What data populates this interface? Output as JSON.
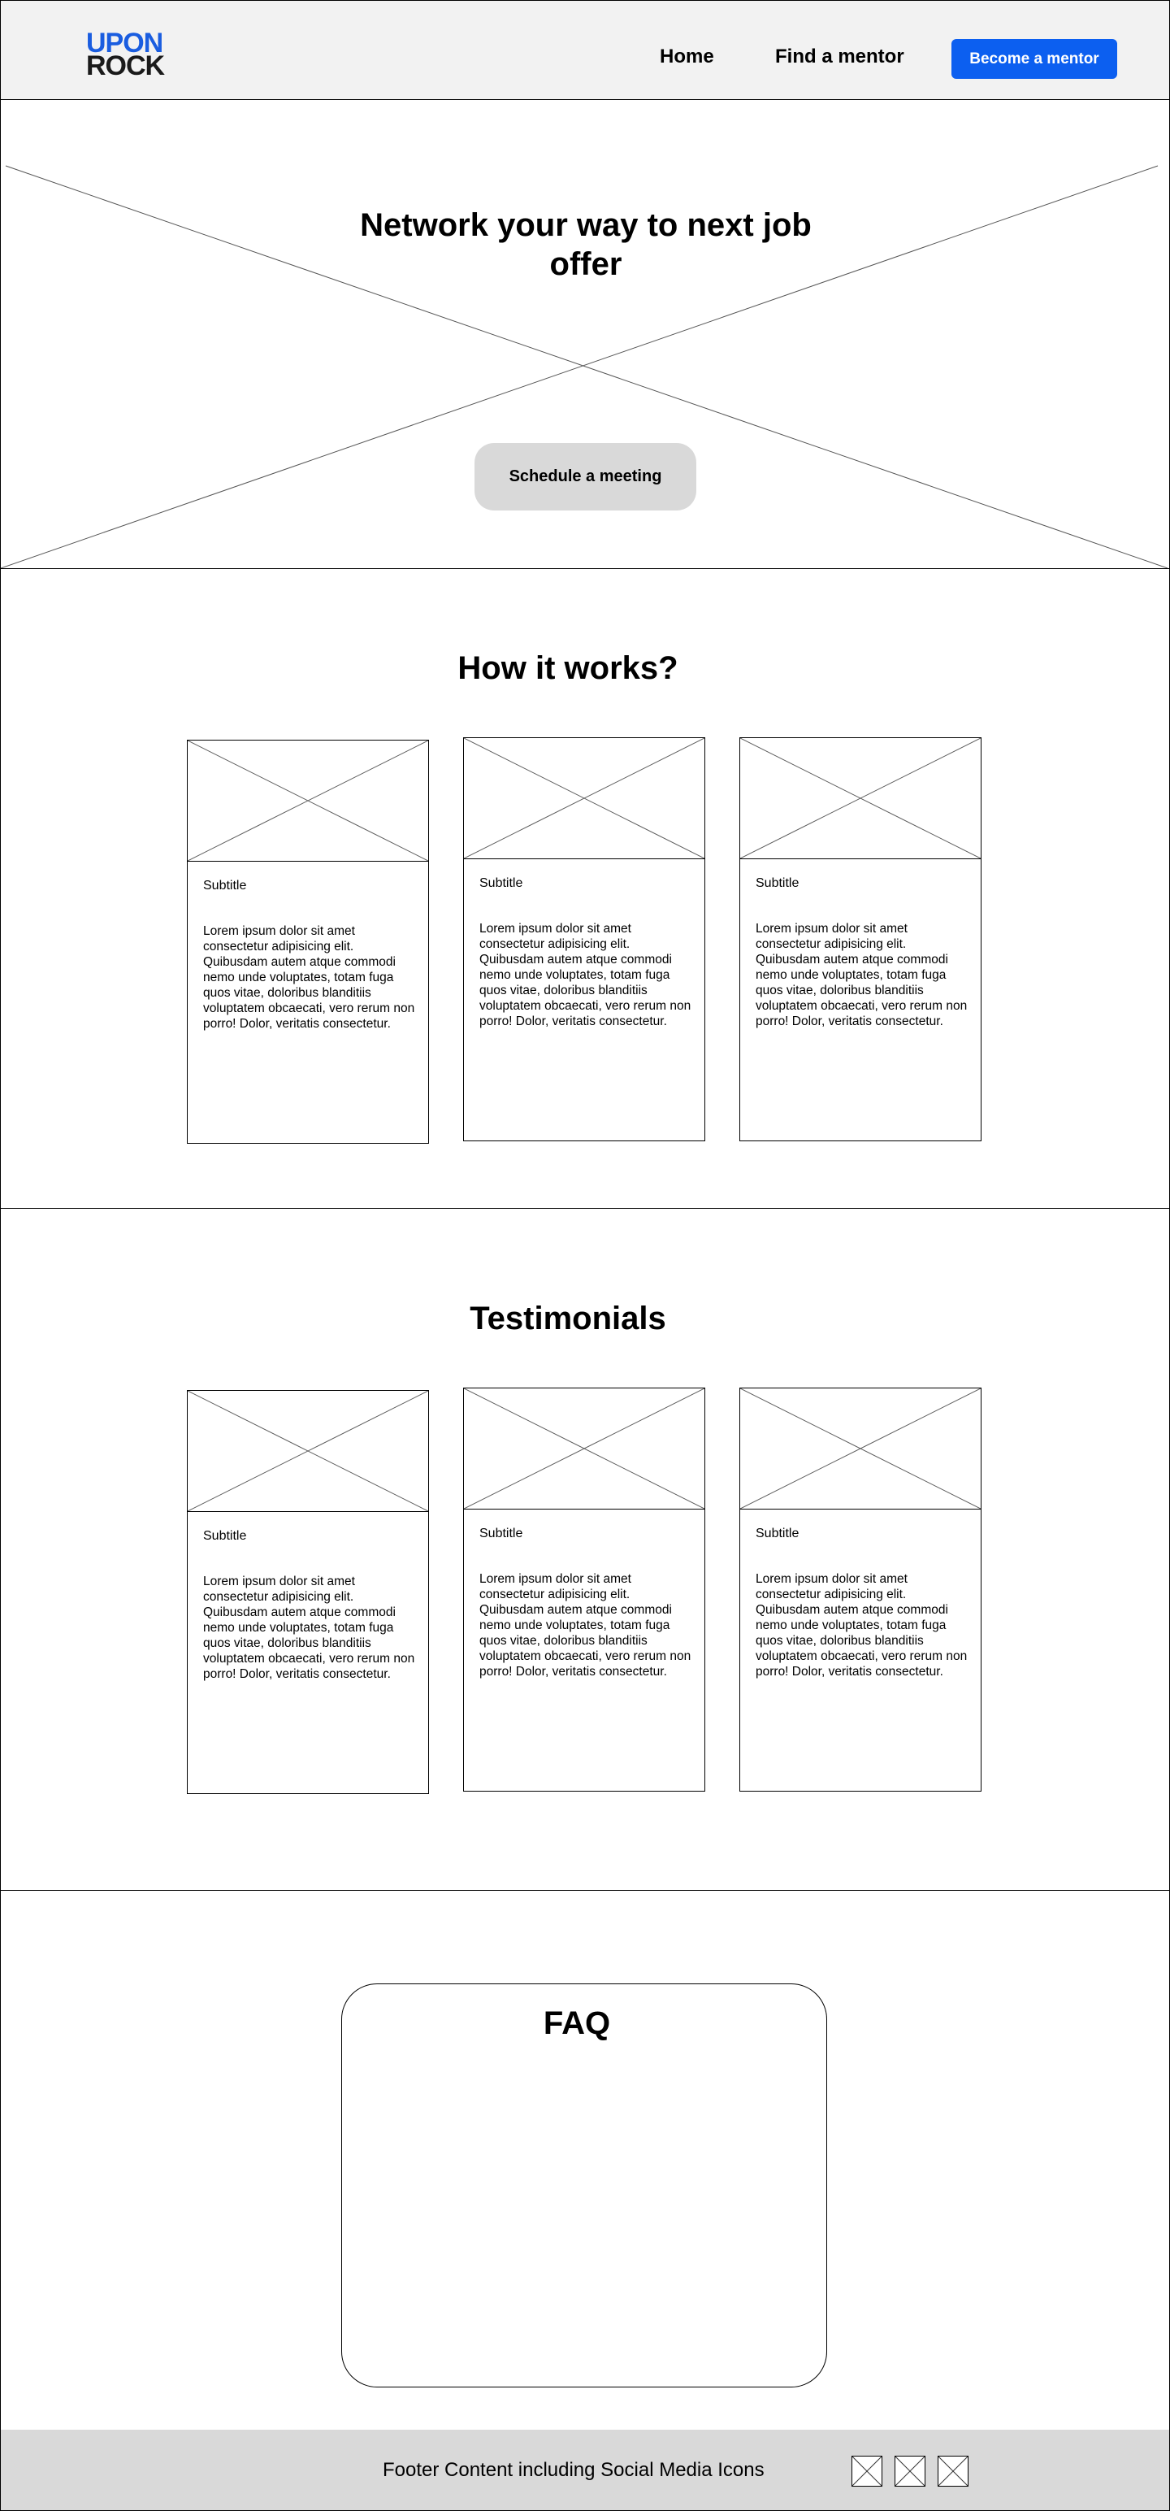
{
  "header": {
    "logo_top": "UPON",
    "logo_bottom": "ROCK",
    "nav_home": "Home",
    "nav_find": "Find a mentor",
    "cta": "Become a mentor"
  },
  "hero": {
    "title": "Network your way to next job offer",
    "button": "Schedule a meeting"
  },
  "how": {
    "title": "How it works?",
    "cards": [
      {
        "subtitle": "Subtitle",
        "body": "Lorem ipsum dolor sit amet consectetur adipisicing elit. Quibusdam autem atque commodi nemo unde voluptates, totam fuga quos vitae, doloribus blanditiis voluptatem obcaecati, vero rerum non porro! Dolor, veritatis consectetur."
      },
      {
        "subtitle": "Subtitle",
        "body": "Lorem ipsum dolor sit amet consectetur adipisicing elit. Quibusdam autem atque commodi nemo unde voluptates, totam fuga quos vitae, doloribus blanditiis voluptatem obcaecati, vero rerum non porro! Dolor, veritatis consectetur."
      },
      {
        "subtitle": "Subtitle",
        "body": "Lorem ipsum dolor sit amet consectetur adipisicing elit. Quibusdam autem atque commodi nemo unde voluptates, totam fuga quos vitae, doloribus blanditiis voluptatem obcaecati, vero rerum non porro! Dolor, veritatis consectetur."
      }
    ]
  },
  "testimonials": {
    "title": "Testimonials",
    "cards": [
      {
        "subtitle": "Subtitle",
        "body": "Lorem ipsum dolor sit amet consectetur adipisicing elit. Quibusdam autem atque commodi nemo unde voluptates, totam fuga quos vitae, doloribus blanditiis voluptatem obcaecati, vero rerum non porro! Dolor, veritatis consectetur."
      },
      {
        "subtitle": "Subtitle",
        "body": "Lorem ipsum dolor sit amet consectetur adipisicing elit. Quibusdam autem atque commodi nemo unde voluptates, totam fuga quos vitae, doloribus blanditiis voluptatem obcaecati, vero rerum non porro! Dolor, veritatis consectetur."
      },
      {
        "subtitle": "Subtitle",
        "body": "Lorem ipsum dolor sit amet consectetur adipisicing elit. Quibusdam autem atque commodi nemo unde voluptates, totam fuga quos vitae, doloribus blanditiis voluptatem obcaecati, vero rerum non porro! Dolor, veritatis consectetur."
      }
    ]
  },
  "faq": {
    "title": "FAQ"
  },
  "footer": {
    "text": "Footer Content including Social Media Icons"
  },
  "colors": {
    "brand_blue": "#1a5de0",
    "cta_blue": "#0c5ff0",
    "header_bg": "#f2f2f2",
    "footer_bg": "#d9d9d9",
    "hero_button_bg": "#d9d9d9"
  }
}
